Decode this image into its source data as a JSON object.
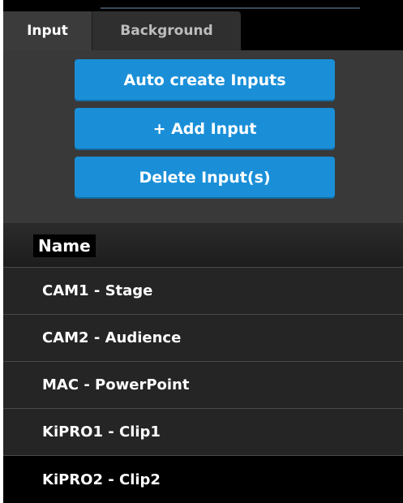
{
  "tabs": [
    {
      "label": "Input",
      "active": true
    },
    {
      "label": "Background",
      "active": false
    }
  ],
  "buttons": {
    "auto_create": "Auto create Inputs",
    "add_input": "+ Add Input",
    "delete_input": "Delete Input(s)"
  },
  "list": {
    "header": "Name",
    "rows": [
      {
        "name": "CAM1 - Stage",
        "selected": false
      },
      {
        "name": "CAM2 - Audience",
        "selected": false
      },
      {
        "name": "MAC - PowerPoint",
        "selected": false
      },
      {
        "name": "KiPRO1 - Clip1",
        "selected": false
      },
      {
        "name": "KiPRO2 - Clip2",
        "selected": true
      }
    ]
  },
  "colors": {
    "accent": "#1a8fd8",
    "panel": "#393939",
    "row": "#252525",
    "selected_row": "#000000"
  }
}
